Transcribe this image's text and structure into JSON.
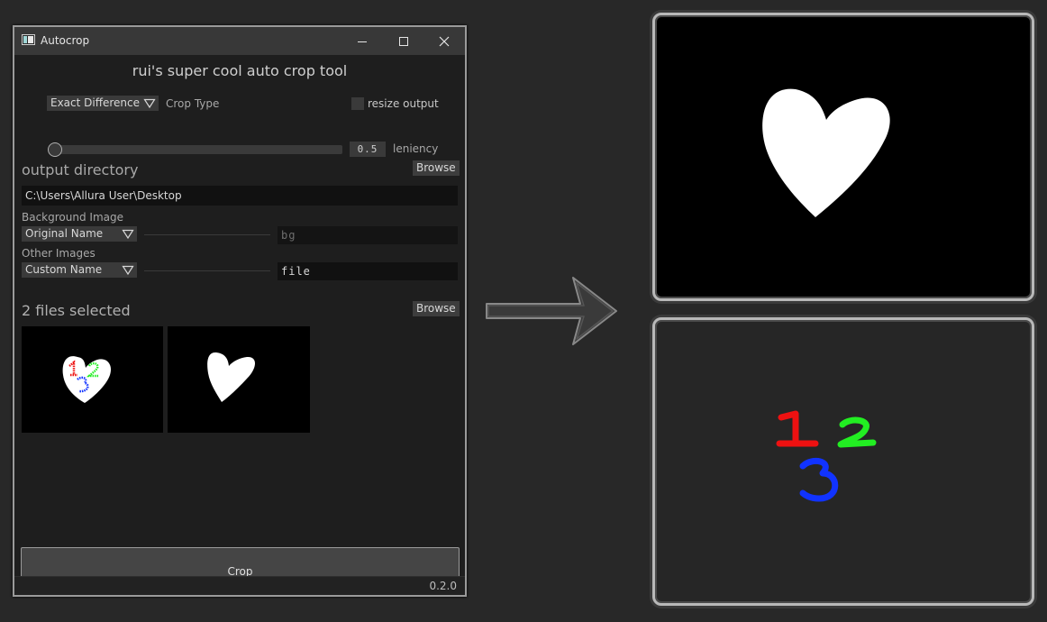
{
  "window": {
    "title": "Autocrop",
    "heading": "rui's super cool auto crop tool",
    "crop_type": {
      "selected": "Exact Difference",
      "label": "Crop Type"
    },
    "resize_output": {
      "label": "resize output",
      "checked": false
    },
    "leniency": {
      "value": "0.5",
      "label": "leniency",
      "fraction": 0.0
    },
    "output_directory": {
      "label": "output directory",
      "browse_label": "Browse",
      "path": "C:\\Users\\Allura User\\Desktop"
    },
    "background_image": {
      "label": "Background Image",
      "name_mode": "Original Name",
      "placeholder": "bg"
    },
    "other_images": {
      "label": "Other Images",
      "name_mode": "Custom Name",
      "value": "file"
    },
    "files": {
      "label": "2 files selected",
      "browse_label": "Browse"
    },
    "crop_button": "Crop",
    "version": "0.2.0"
  },
  "colors": {
    "red": "#ee1111",
    "green": "#22ee22",
    "blue": "#1133ff",
    "frame": "#b8b8b8"
  },
  "icons": [
    "app-icon",
    "minimize-icon",
    "maximize-icon",
    "close-icon",
    "dropdown-arrow-icon",
    "right-arrow-icon"
  ]
}
